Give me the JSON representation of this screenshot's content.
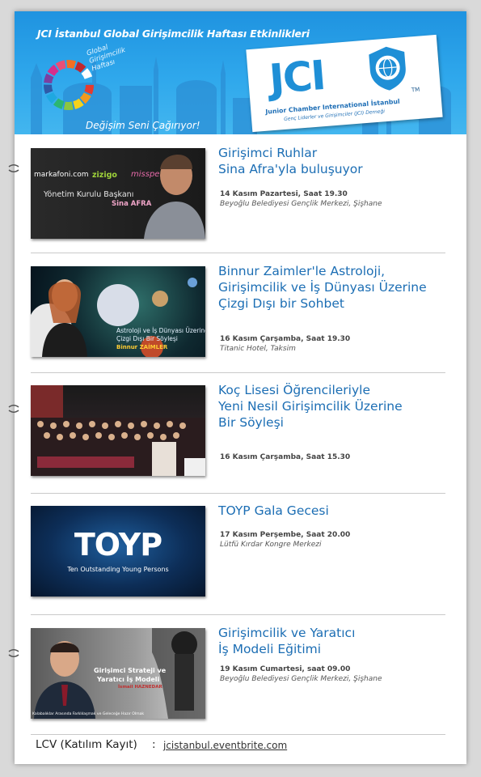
{
  "header": {
    "title": "JCI İstanbul Global Girişimcilik Haftası Etkinlikleri",
    "logo_text": [
      "Global",
      "Girişimcilik",
      "Haftası"
    ],
    "slogan": "Değişim Seni Çağırıyor!",
    "jci_word": "JCI",
    "jci_tm": "TM",
    "jci_org": "Junior Chamber International İstanbul",
    "jci_org_sub": "Genç Liderler ve Girişimciler (JCI) Derneği",
    "brand_color": "#1f8fd6"
  },
  "events": [
    {
      "title": [
        "Girişimci Ruhlar",
        "Sina Afra'yla buluşuyor"
      ],
      "date": "14 Kasım Pazartesi, Saat 19.30",
      "venue": "Beyoğlu Belediyesi Gençlik Merkezi, Şişhane",
      "thumb": {
        "brands": [
          "markafoni.com",
          "zizigo",
          "misspera"
        ],
        "caption": "Yönetim Kurulu Başkanı",
        "name": "Sina AFRA"
      }
    },
    {
      "title": [
        "Binnur Zaimler'le Astroloji,",
        "Girişimcilik ve İş Dünyası Üzerine",
        "Çizgi Dışı bir Sohbet"
      ],
      "date": "16 Kasım Çarşamba, Saat 19.30",
      "venue": "Titanic Hotel, Taksim",
      "thumb": {
        "line1": "Astroloji ve İş Dünyası Üzerine",
        "line2": "Çizgi Dışı Bir Söyleşi",
        "name": "Binnur ZAİMLER"
      }
    },
    {
      "title": [
        "Koç Lisesi Öğrencileriyle",
        "Yeni Nesil Girişimcilik Üzerine",
        "Bir Söyleşi"
      ],
      "date": "16 Kasım Çarşamba, Saat 15.30",
      "venue": ""
    },
    {
      "title": [
        "TOYP Gala Gecesi"
      ],
      "date": "17 Kasım Perşembe, Saat 20.00",
      "venue": "Lütfü Kırdar Kongre Merkezi",
      "thumb": {
        "logo": "TOYP",
        "tagline": "Ten Outstanding Young Persons"
      }
    },
    {
      "title": [
        "Girişimcilik ve Yaratıcı",
        "İş Modeli Eğitimi"
      ],
      "date": "19 Kasım Cumartesi, saat 09.00",
      "venue": "Beyoğlu Belediyesi Gençlik Merkezi, Şişhane",
      "thumb": {
        "line1": "Girişimci Strateji ve",
        "line2": "Yaratıcı İş Modeli",
        "name": "İsmail HAZNEDAR",
        "bottom": "Kalabalıklar Arasında Farklılaşmak ve Geleceğe Hazır Olmak"
      }
    }
  ],
  "footer": {
    "label": "LCV (Katılım Kayıt)",
    "colon": ":",
    "link": "jcistanbul.eventbrite.com"
  }
}
